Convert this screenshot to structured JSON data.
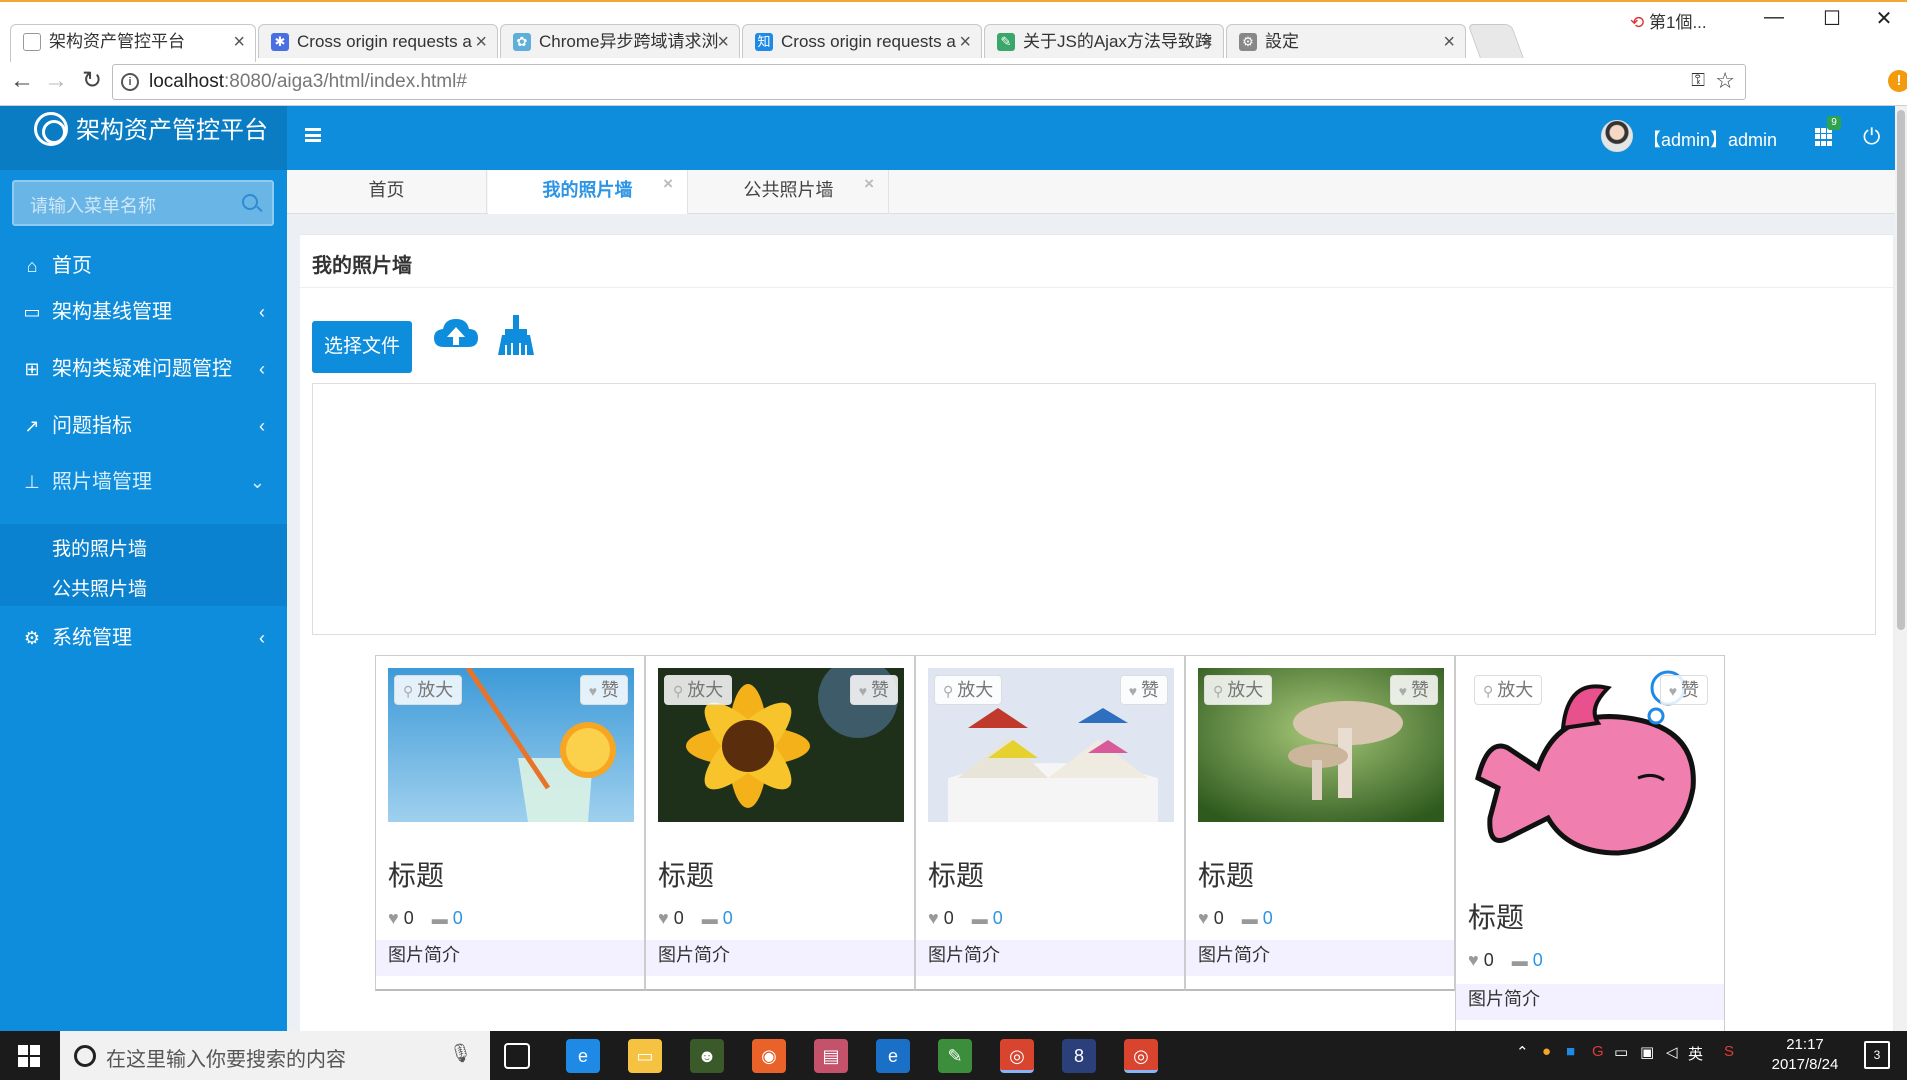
{
  "browser": {
    "tabs": [
      {
        "title": "架构资产管控平台",
        "icon": "page-icon"
      },
      {
        "title": "Cross origin requests a",
        "icon": "paw-icon"
      },
      {
        "title": "Chrome异步跨域请求浏",
        "icon": "gear-blue-icon"
      },
      {
        "title": "Cross origin requests a",
        "icon": "zhihu-icon"
      },
      {
        "title": "关于JS的Ajax方法导致跨",
        "icon": "pen-icon"
      },
      {
        "title": "設定",
        "icon": "settings-icon"
      }
    ],
    "extension_label": "第1個...",
    "url_host": "localhost",
    "url_rest": ":8080/aiga3/html/index.html#"
  },
  "app": {
    "name": "架构资产管控平台",
    "search_placeholder": "请输入菜单名称",
    "menu": [
      {
        "label": "首页",
        "icon": "home-icon"
      },
      {
        "label": "架构基线管理",
        "icon": "monitor-icon"
      },
      {
        "label": "架构类疑难问题管控",
        "icon": "windows-icon"
      },
      {
        "label": "问题指标",
        "icon": "line-chart-icon"
      },
      {
        "label": "照片墙管理",
        "icon": "sitemap-icon"
      },
      {
        "label": "系统管理",
        "icon": "cogs-icon"
      }
    ],
    "submenu": [
      "我的照片墙",
      "公共照片墙"
    ],
    "user": "【admin】admin",
    "apps_badge": "9",
    "page_tabs": [
      "首页",
      "我的照片墙",
      "公共照片墙"
    ],
    "panel_title": "我的照片墙",
    "pick_button": "选择文件",
    "cards": [
      {
        "title": "标题",
        "likes": "0",
        "comments": "0",
        "desc": "图片简介",
        "zoom": "放大",
        "like": "赞",
        "image": "drink"
      },
      {
        "title": "标题",
        "likes": "0",
        "comments": "0",
        "desc": "图片简介",
        "zoom": "放大",
        "like": "赞",
        "image": "sunflower"
      },
      {
        "title": "标题",
        "likes": "0",
        "comments": "0",
        "desc": "图片简介",
        "zoom": "放大",
        "like": "赞",
        "image": "paper-boats"
      },
      {
        "title": "标题",
        "likes": "0",
        "comments": "0",
        "desc": "图片简介",
        "zoom": "放大",
        "like": "赞",
        "image": "mushroom"
      },
      {
        "title": "标题",
        "likes": "0",
        "comments": "0",
        "desc": "图片简介",
        "zoom": "放大",
        "like": "赞",
        "image": "pink-fish"
      }
    ]
  },
  "taskbar": {
    "search_placeholder": "在这里输入你要搜索的内容",
    "ime": "英",
    "time": "21:17",
    "date": "2017/8/24",
    "notifications": "3"
  }
}
